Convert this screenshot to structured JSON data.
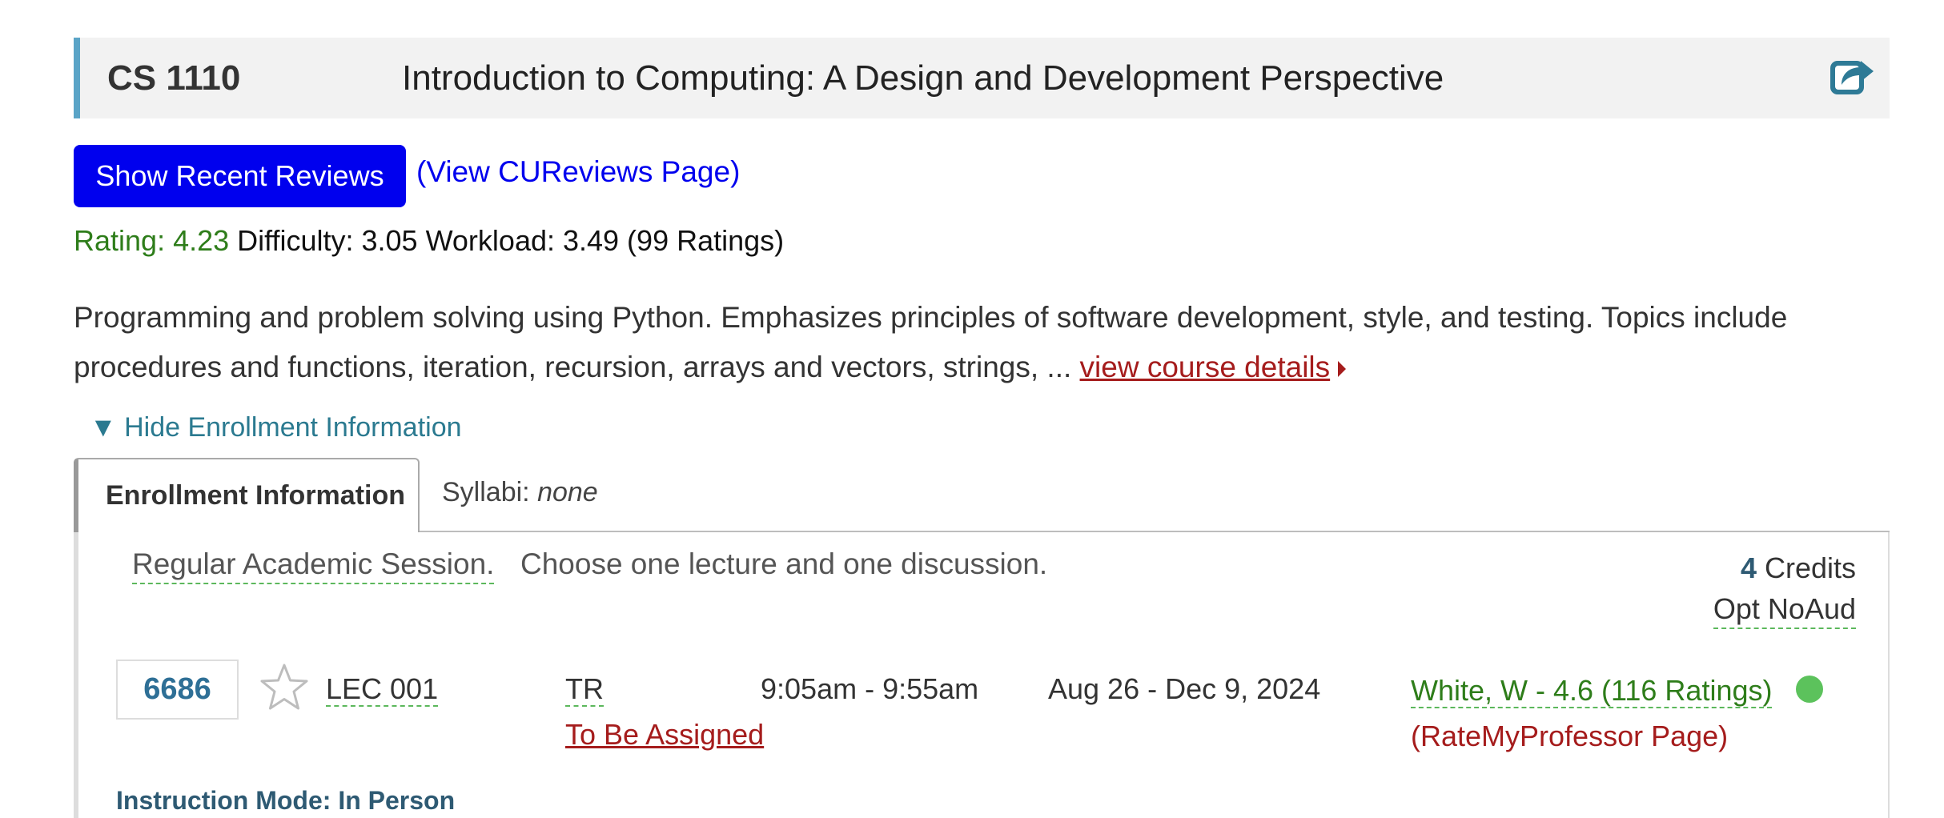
{
  "course": {
    "code": "CS 1110",
    "title": "Introduction to Computing: A Design and Development Perspective"
  },
  "reviews": {
    "show_button": "Show Recent Reviews",
    "cureviews_link": "(View CUReviews Page)"
  },
  "ratings": {
    "rating": "Rating: 4.23",
    "rest": " Difficulty: 3.05 Workload: 3.49 (99 Ratings)"
  },
  "description": {
    "text": "Programming and problem solving using Python. Emphasizes principles of software development, style, and testing. Topics include procedures and functions, iteration, recursion, arrays and vectors, strings, ... ",
    "details_link": "view course details"
  },
  "enrollment_toggle": "▼ Hide Enrollment Information",
  "tabs": {
    "enrollment": "Enrollment Information",
    "syllabi_label": "Syllabi: ",
    "syllabi_value": "none"
  },
  "session": {
    "name": "Regular Academic Session.",
    "note": "Choose one lecture and one discussion.",
    "credits_number": "4",
    "credits_label": " Credits",
    "grading": "Opt NoAud"
  },
  "section": {
    "class_number": "6686",
    "label": "LEC 001",
    "days": "TR",
    "time": "9:05am - 9:55am",
    "dates": "Aug 26 - Dec 9, 2024",
    "location": "To Be Assigned",
    "instructor": "White, W - 4.6 (116 Ratings)",
    "rmp_link": "(RateMyProfessor Page)",
    "status_color": "#5cc25c"
  },
  "instruction_mode": "Instruction Mode: In Person",
  "icons": {
    "share": "share-icon",
    "star": "star-icon"
  }
}
